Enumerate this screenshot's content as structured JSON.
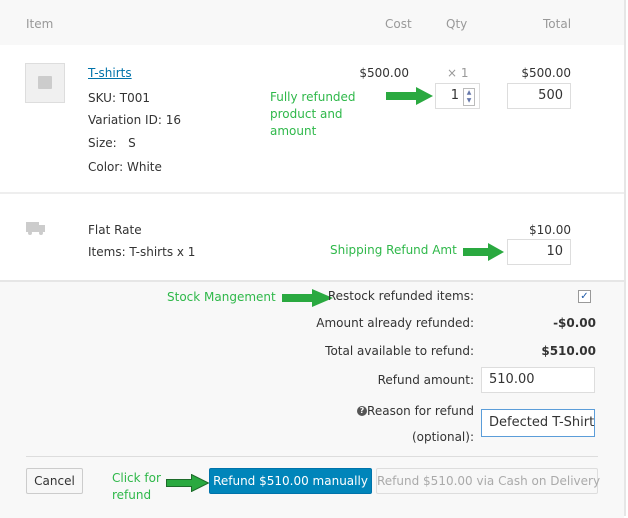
{
  "header": {
    "item": "Item",
    "cost": "Cost",
    "qty": "Qty",
    "total": "Total"
  },
  "line_item": {
    "name": "T-shirts",
    "sku": "SKU: T001",
    "variation": "Variation ID: 16",
    "size": "Size:   S",
    "color": "Color: White",
    "cost": "$500.00",
    "qty": "× 1",
    "total": "$500.00",
    "refund_qty": "1",
    "refund_total": "500"
  },
  "shipping": {
    "name": "Flat Rate",
    "items": "Items: T-shirts x 1",
    "total": "$10.00",
    "refund_total": "10"
  },
  "refund": {
    "restock_label": "Restock refunded items:",
    "restock_checked": true,
    "already_label": "Amount already refunded:",
    "already_value": "-$0.00",
    "available_label": "Total available to refund:",
    "available_value": "$510.00",
    "amount_label": "Refund amount:",
    "amount_value": "510.00",
    "reason_label": "Reason for refund",
    "reason_label2": "(optional):",
    "reason_value": "Defected T-Shirt"
  },
  "buttons": {
    "cancel": "Cancel",
    "manual": "Refund $510.00 manually",
    "gateway": "Refund $510.00 via Cash on Delivery"
  },
  "annotations": {
    "fully1": "Fully refunded",
    "fully2": "product and",
    "fully3": "amount",
    "shipping": "Shipping Refund Amt",
    "stock": "Stock Mangement",
    "click1": "Click for",
    "click2": "refund"
  },
  "colors": {
    "accent": "#0085ba",
    "annotation": "#2fb84a",
    "link": "#0073aa"
  }
}
